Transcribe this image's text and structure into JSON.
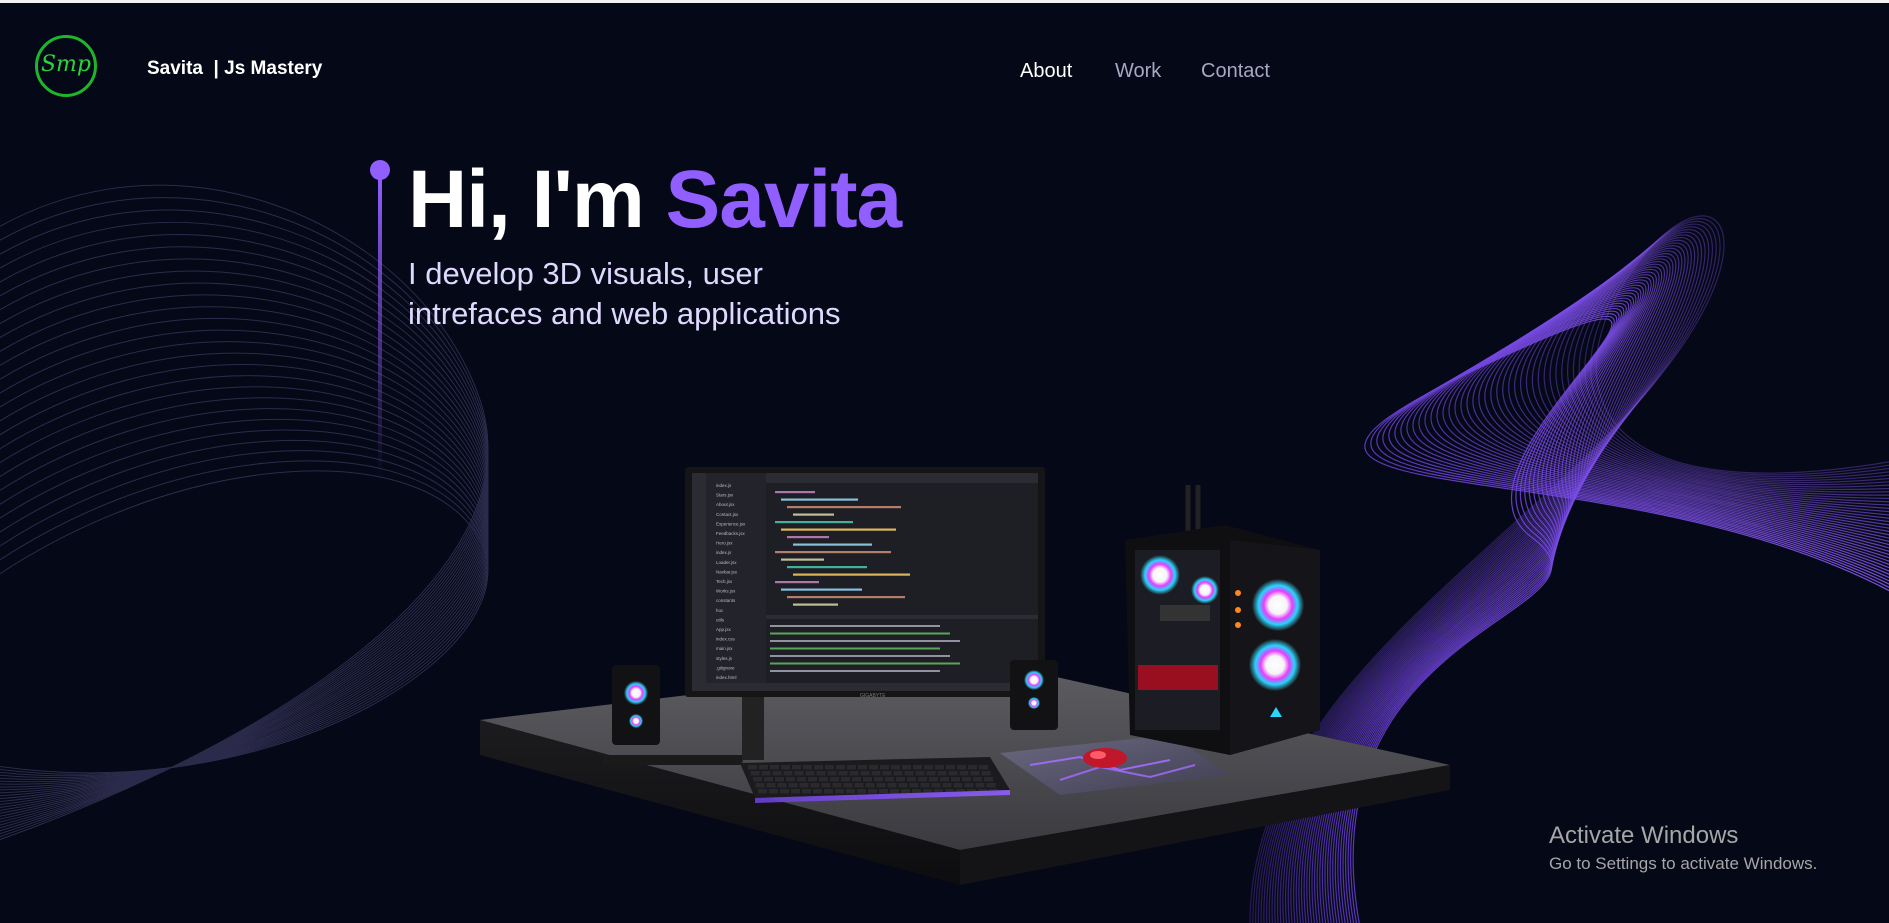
{
  "navbar": {
    "logo_text": "Smp",
    "brand": "Savita  | Js Mastery",
    "links": [
      {
        "label": "About",
        "active": true
      },
      {
        "label": "Work",
        "active": false
      },
      {
        "label": "Contact",
        "active": false
      }
    ]
  },
  "hero": {
    "title_prefix": "Hi, I'm ",
    "title_name": "Savita",
    "subtitle_line1": "I develop 3D visuals, user",
    "subtitle_line2": "intrefaces and web applications"
  },
  "scene": {
    "description_icon": "desktop-pc-3d-model",
    "monitor_brand": "GIGABYTE",
    "editor_tabs": [
      "index.jsx",
      "styles.js",
      "Computers.jsx",
      "Loader.jsx",
      "index.js",
      "Tech.jsx"
    ],
    "editor_files": [
      "index.js",
      "Stars.jsx",
      "About.jsx",
      "Contact.jsx",
      "Experience.jsx",
      "Feedbacks.jsx",
      "Hero.jsx",
      "index.js",
      "Loader.jsx",
      "Navbar.jsx",
      "Tech.jsx",
      "Works.jsx",
      "constants",
      "hoc",
      "utils",
      "App.jsx",
      "index.css",
      "main.jsx",
      "styles.js",
      ".gitignore",
      "index.html"
    ]
  },
  "watermark": {
    "title": "Activate Windows",
    "subtitle": "Go to Settings to activate Windows."
  },
  "colors": {
    "background": "#050816",
    "accent": "#915eff",
    "logo_green": "#1fb52a",
    "nav_inactive": "#aaa6c3",
    "text": "#ffffff"
  }
}
